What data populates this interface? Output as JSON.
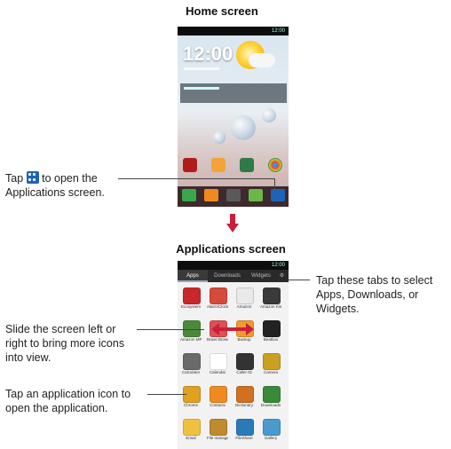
{
  "home_title": "Home screen",
  "apps_title": "Applications screen",
  "callouts": {
    "tap_prefix": "Tap",
    "tap_suffix": "to open the",
    "tap_line2": "Applications screen.",
    "tabs_text": "Tap these tabs to select Apps, Downloads, or Widgets.",
    "slide_text": "Slide the screen left or right to bring more icons into view.",
    "icon_text": "Tap an application icon to open the application."
  },
  "home_screen": {
    "status_time": "12:00",
    "clock": "12:00"
  },
  "apps_screen": {
    "status_time": "12:00",
    "tabs": [
      "Apps",
      "Downloads",
      "Widgets"
    ],
    "apps": [
      {
        "label": "Ecosystem",
        "color": "#c8282a"
      },
      {
        "label": "Alarm/Clock",
        "color": "#d64a3c"
      },
      {
        "label": "Amazon",
        "color": "#e9e9e9"
      },
      {
        "label": "Amazon Kindle",
        "color": "#3a3a3a"
      },
      {
        "label": "Amazon MP3",
        "color": "#4a8a3a"
      },
      {
        "label": "Brave Browser",
        "color": "#e05050"
      },
      {
        "label": "Backup",
        "color": "#f09a30"
      },
      {
        "label": "Beatbox",
        "color": "#222222"
      },
      {
        "label": "Calculator",
        "color": "#6a6a6a"
      },
      {
        "label": "Calendar",
        "color": "#ffffff"
      },
      {
        "label": "Caller ID",
        "color": "#333333"
      },
      {
        "label": "Camera",
        "color": "#c9a020"
      },
      {
        "label": "Chrome",
        "color": "#e0a020"
      },
      {
        "label": "Contacts",
        "color": "#f08a20"
      },
      {
        "label": "Dictionary",
        "color": "#d07020"
      },
      {
        "label": "Downloads",
        "color": "#3a8a3a"
      },
      {
        "label": "Email",
        "color": "#f0c040"
      },
      {
        "label": "File manager",
        "color": "#c08a30"
      },
      {
        "label": "FileShare",
        "color": "#2a7ab8"
      },
      {
        "label": "Gallery",
        "color": "#4a9ad0"
      }
    ]
  },
  "colors": {
    "arrow": "#c8203a",
    "grid_icon": "#1d63b8"
  }
}
